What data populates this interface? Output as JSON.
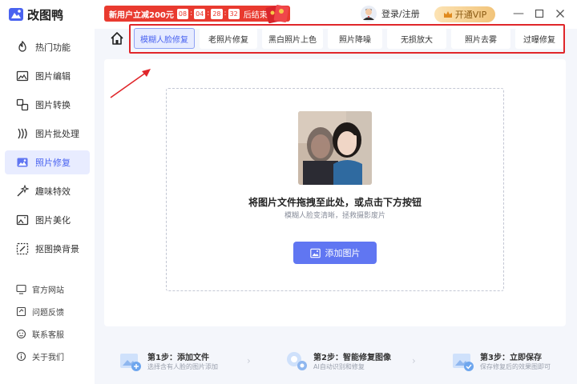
{
  "app": {
    "title": "改图鸭"
  },
  "promo": {
    "text": "新用户立减200元",
    "countdown": [
      "08",
      "04",
      "28",
      "32"
    ],
    "suffix": "后结束"
  },
  "header": {
    "login_label": "登录/注册",
    "vip_label": "开通VIP"
  },
  "sidebar": {
    "items": [
      {
        "label": "热门功能",
        "icon": "flame-icon"
      },
      {
        "label": "图片编辑",
        "icon": "image-edit-icon"
      },
      {
        "label": "图片转换",
        "icon": "convert-icon"
      },
      {
        "label": "图片批处理",
        "icon": "batch-icon"
      },
      {
        "label": "照片修复",
        "icon": "photo-repair-icon",
        "active": true
      },
      {
        "label": "趣味特效",
        "icon": "sparkle-icon"
      },
      {
        "label": "图片美化",
        "icon": "beautify-icon"
      },
      {
        "label": "抠图换背景",
        "icon": "cutout-icon"
      }
    ],
    "footer": [
      {
        "label": "官方网站",
        "icon": "monitor-icon"
      },
      {
        "label": "问题反馈",
        "icon": "feedback-icon"
      },
      {
        "label": "联系客服",
        "icon": "service-icon"
      },
      {
        "label": "关于我们",
        "icon": "info-icon"
      }
    ]
  },
  "tabs": [
    {
      "label": "模糊人脸修复",
      "active": true
    },
    {
      "label": "老照片修复"
    },
    {
      "label": "黑白照片上色"
    },
    {
      "label": "照片降噪"
    },
    {
      "label": "无损放大"
    },
    {
      "label": "照片去雾"
    },
    {
      "label": "过曝修复"
    }
  ],
  "dropzone": {
    "title": "将图片文件拖拽至此处，或点击下方按钮",
    "subtitle": "模糊人脸变清晰，拯救摄影废片",
    "button_label": "添加图片"
  },
  "steps": [
    {
      "title": "第1步：添加文件",
      "desc": "选择含有人脸的图片添加"
    },
    {
      "title": "第2步：智能修复图像",
      "desc": "AI自动识别和修复"
    },
    {
      "title": "第3步：立即保存",
      "desc": "保存修复后的效果图即可"
    }
  ],
  "colors": {
    "accent": "#6076f2",
    "promo_red": "#e93a2f",
    "highlight_red": "#e0262a",
    "vip_gold": "#f2c47a"
  }
}
